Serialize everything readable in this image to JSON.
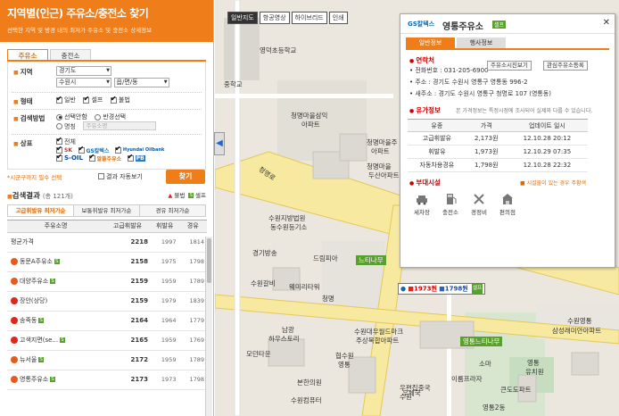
{
  "panel": {
    "title": "지역별(인근) 주유소/충전소 찾기",
    "subtitle": "선택한 지역 및 방경 내의 최저가 주유소 및 충전소 상세정보",
    "tabs": [
      "주유소",
      "충전소"
    ],
    "region": {
      "label": "지역",
      "sido": "경기도",
      "sigungu": "수원시",
      "dong": "읍/면/동"
    },
    "type": {
      "label": "형태",
      "options": [
        "일반",
        "셀프",
        "불법"
      ]
    },
    "method": {
      "label": "검색방법",
      "opt1": "선택안함",
      "opt2": "반경선택",
      "opt3": "명칭",
      "placeholder": "주유소명"
    },
    "brand": {
      "label": "상표",
      "all": "전체",
      "brands": [
        "SK",
        "GS칼텍스",
        "Hyundai Oilbank",
        "S-OIL",
        "알뜰주유소",
        "PB"
      ]
    },
    "required_note": "*시군구까지 필수 선택",
    "within": "결과 자동보기",
    "search": "찾기"
  },
  "results": {
    "title": "검색결과",
    "count": "(총 121개)",
    "legend_open": "불법",
    "legend_self": "셀프",
    "sort_tabs": [
      "고급휘발유 최저가순",
      "보통휘발유 최저가순",
      "경유 최저가순"
    ],
    "headers": [
      "주유소명",
      "고급휘발유",
      "휘발유",
      "경유"
    ],
    "rows": [
      {
        "name": "평균가격",
        "p1": "2218",
        "p2": "1997",
        "p3": "1814",
        "icon": "",
        "self": false
      },
      {
        "name": "동문A주유소",
        "p1": "2158",
        "p2": "1975",
        "p3": "1798",
        "icon": "#e85a1b",
        "self": true
      },
      {
        "name": "대양주유소",
        "p1": "2159",
        "p2": "1959",
        "p3": "1789",
        "icon": "#e85a1b",
        "self": true
      },
      {
        "name": "장안(상당)",
        "p1": "2159",
        "p2": "1979",
        "p3": "1839",
        "icon": "#e1251b",
        "self": false
      },
      {
        "name": "송죽동",
        "p1": "2164",
        "p2": "1964",
        "p3": "1779",
        "icon": "#e1251b",
        "self": true
      },
      {
        "name": "고색지면(se...",
        "p1": "2165",
        "p2": "1959",
        "p3": "1769",
        "icon": "#e1251b",
        "self": true
      },
      {
        "name": "뉴서울",
        "p1": "2172",
        "p2": "1959",
        "p3": "1789",
        "icon": "#e85a1b",
        "self": true
      },
      {
        "name": "영통주유소",
        "p1": "2173",
        "p2": "1973",
        "p3": "1798",
        "icon": "#e85a1b",
        "self": true
      }
    ]
  },
  "map": {
    "view_buttons": [
      "일반지도",
      "항공영상",
      "하이브리드",
      "인쇄"
    ],
    "labels": [
      "영덕초등학교",
      "중학교",
      "청명마을삼익",
      "아파트",
      "청명마을",
      "두산아파트",
      "청명마을주",
      "아파트",
      "수원지방법원",
      "동수원등기소",
      "경기방송",
      "드림피아",
      "느티나무",
      "수원갈비",
      "웨미리타워",
      "남광",
      "하우스토리",
      "모던타운",
      "수원대우월드마크",
      "주상복합아파트",
      "협수원",
      "영통",
      "우체국",
      "수원",
      "우편집중국",
      "영통느티나무",
      "소마",
      "영통",
      "유치원",
      "이룸프라자",
      "큰도도파트",
      "수원영통",
      "삼성래미안아파트",
      "본한의원",
      "수원컴퓨터",
      "영통2동",
      "청명로",
      "청명"
    ]
  },
  "marker": {
    "p1": "1973원",
    "p2": "1798원",
    "self": "셀프"
  },
  "popup": {
    "brand": "GS칼텍스",
    "name": "영통주유소",
    "self": "셀프",
    "tabs": [
      "일반정보",
      "행사정보"
    ],
    "contact_title": "연락처",
    "btn_a": "주유소시진보기",
    "btn_b": "관심주유소등록",
    "lines": [
      "• 전화번호 : 031-205-6900",
      "• 주소 : 경기도 수원시 영통구 영통동 996-2",
      "• 새주소 : 경기도 수원시 영통구 청명로 107 (영통동)"
    ],
    "price_title": "유가정보",
    "price_note": "본 가격정보는 특정시점에 조사되어 실제와 다를 수 있습니다.",
    "price_headers": [
      "유종",
      "가격",
      "업데이트 일시"
    ],
    "prices": [
      [
        "고급휘발유",
        "2,173원",
        "12.10.28 20:12"
      ],
      [
        "휘발유",
        "1,973원",
        "12.10.29 07:35"
      ],
      [
        "자동차용경유",
        "1,798원",
        "12.10.28 22:32"
      ]
    ],
    "fac_title": "부대시설",
    "fac_note": "■ 시설물이 있는 경우 주황색",
    "facilities": [
      "세차장",
      "충전소",
      "경정비",
      "편의점"
    ]
  }
}
